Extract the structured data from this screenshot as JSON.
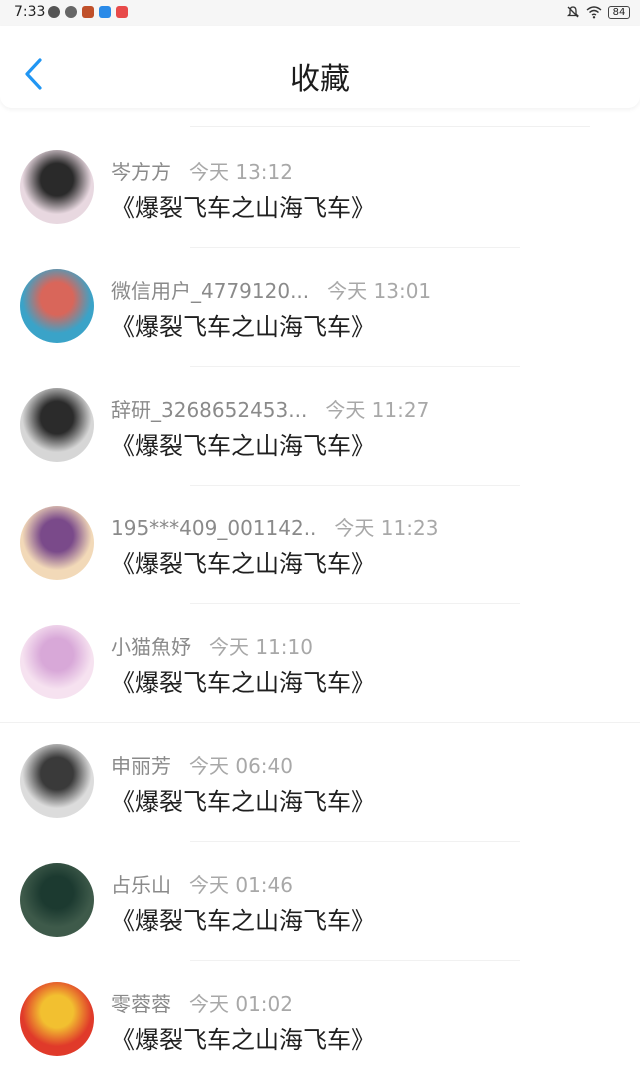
{
  "status_bar": {
    "time": "7:33",
    "battery": "84",
    "icons_left": [
      "wechat-icon",
      "browser-icon",
      "app-icon",
      "cloud-icon",
      "app-red-icon"
    ],
    "icons_right": [
      "mute-icon",
      "wifi-icon",
      "battery-icon"
    ]
  },
  "header": {
    "title": "收藏",
    "back_icon": "chevron-left-icon",
    "accent": "#2196f3"
  },
  "items": [
    {
      "name": "岑方方",
      "time": "今天 13:12",
      "message": "《爆裂飞车之山海飞车》",
      "avatar_colors": [
        "#e8d8e0",
        "#2a2a2a"
      ]
    },
    {
      "name": "微信用户_4779120...",
      "time": "今天 13:01",
      "message": "《爆裂飞车之山海飞车》",
      "avatar_colors": [
        "#3aa3c8",
        "#d9665a"
      ]
    },
    {
      "name": "辞研_3268652453...",
      "time": "今天 11:27",
      "message": "《爆裂飞车之山海飞车》",
      "avatar_colors": [
        "#d6d6d6",
        "#2b2b2b"
      ]
    },
    {
      "name": "195***409_001142..",
      "time": "今天 11:23",
      "message": "《爆裂飞车之山海飞车》",
      "avatar_colors": [
        "#f2d9b8",
        "#7a4a8a"
      ]
    },
    {
      "name": "小猫魚妤",
      "time": "今天 11:10",
      "message": "《爆裂飞车之山海飞车》",
      "avatar_colors": [
        "#f6e2f0",
        "#d8a8d8"
      ]
    },
    {
      "name": "申丽芳",
      "time": "今天 06:40",
      "message": "《爆裂飞车之山海飞车》",
      "avatar_colors": [
        "#dcdcdc",
        "#3a3a3a"
      ]
    },
    {
      "name": "占乐山",
      "time": "今天 01:46",
      "message": "《爆裂飞车之山海飞车》",
      "avatar_colors": [
        "#3e5a4a",
        "#1c3a30"
      ]
    },
    {
      "name": "零蓉蓉",
      "time": "今天 01:02",
      "message": "《爆裂飞车之山海飞车》",
      "avatar_colors": [
        "#e03a2a",
        "#f2c030"
      ]
    }
  ]
}
